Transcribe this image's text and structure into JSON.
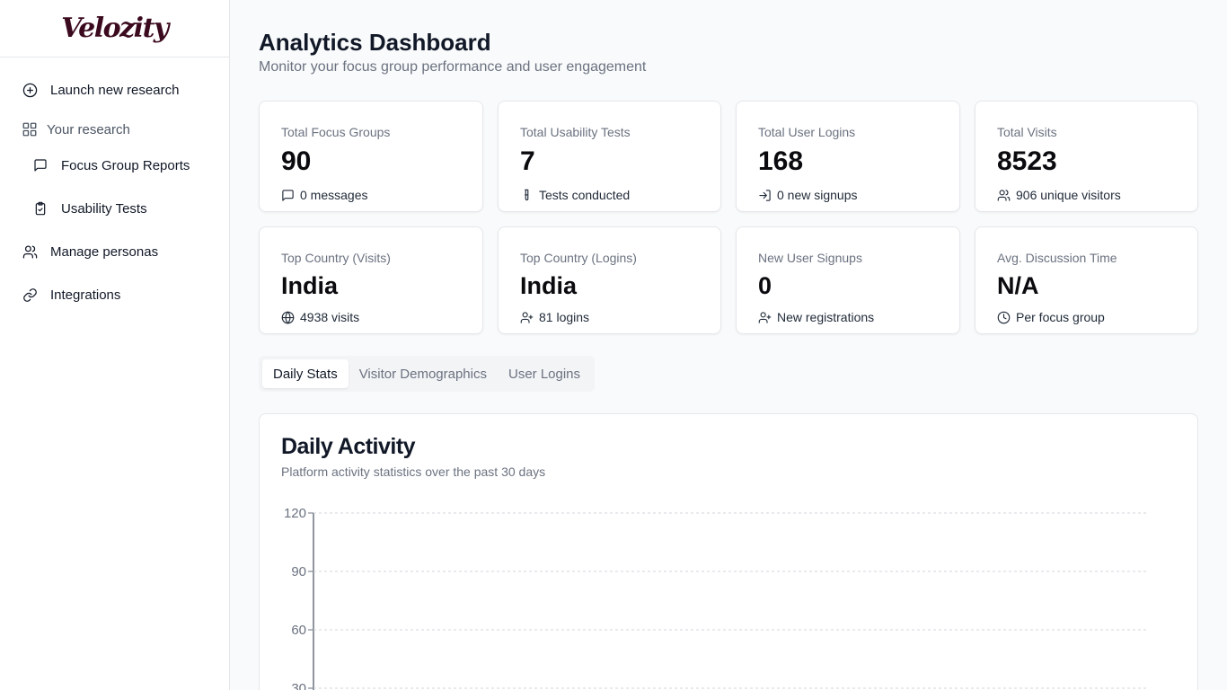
{
  "app": {
    "logo": "Velozity"
  },
  "sidebar": {
    "items": [
      {
        "label": "Launch new research",
        "icon": "plus-circle-icon"
      },
      {
        "label": "Your research",
        "icon": "grid-icon"
      },
      {
        "label": "Focus Group Reports",
        "icon": "message-square-icon"
      },
      {
        "label": "Usability Tests",
        "icon": "clipboard-check-icon"
      },
      {
        "label": "Manage personas",
        "icon": "users-icon"
      },
      {
        "label": "Integrations",
        "icon": "link-icon"
      }
    ]
  },
  "header": {
    "title": "Analytics Dashboard",
    "subtitle": "Monitor your focus group performance and user engagement"
  },
  "cards": [
    {
      "label": "Total Focus Groups",
      "value": "90",
      "sub": "0 messages",
      "icon": "message-square-icon"
    },
    {
      "label": "Total Usability Tests",
      "value": "7",
      "sub": "Tests conducted",
      "icon": "test-tube-icon"
    },
    {
      "label": "Total User Logins",
      "value": "168",
      "sub": "0 new signups",
      "icon": "log-in-icon"
    },
    {
      "label": "Total Visits",
      "value": "8523",
      "sub": "906 unique visitors",
      "icon": "users-icon"
    },
    {
      "label": "Top Country (Visits)",
      "value": "India",
      "sub": "4938 visits",
      "icon": "globe-icon"
    },
    {
      "label": "Top Country (Logins)",
      "value": "India",
      "sub": "81 logins",
      "icon": "user-plus-icon"
    },
    {
      "label": "New User Signups",
      "value": "0",
      "sub": "New registrations",
      "icon": "user-plus-icon"
    },
    {
      "label": "Avg. Discussion Time",
      "value": "N/A",
      "sub": "Per focus group",
      "icon": "clock-icon"
    }
  ],
  "tabs": [
    {
      "label": "Daily Stats",
      "active": true
    },
    {
      "label": "Visitor Demographics",
      "active": false
    },
    {
      "label": "User Logins",
      "active": false
    }
  ],
  "panel": {
    "title": "Daily Activity",
    "subtitle": "Platform activity statistics over the past 30 days"
  },
  "chart_data": {
    "type": "line",
    "title": "Daily Activity",
    "xlabel": "",
    "ylabel": "",
    "yticks": [
      120,
      90,
      60,
      30
    ],
    "ylim": [
      0,
      120
    ],
    "grid": true,
    "series": []
  },
  "colors": {
    "brand": "#3b0a1e",
    "border": "#e5e7eb",
    "muted_text": "#6b7280"
  }
}
